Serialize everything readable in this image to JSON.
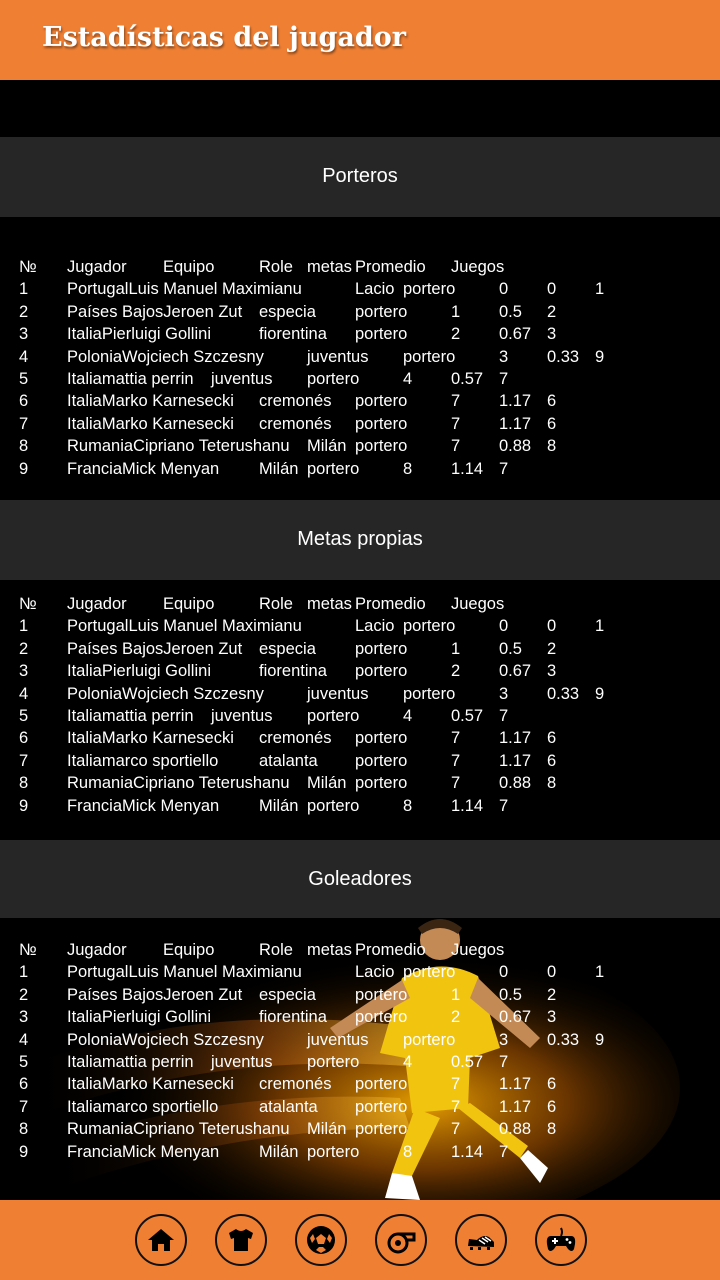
{
  "header": {
    "title": "Estadísticas del jugador"
  },
  "columns": [
    "№",
    "Jugador",
    "Equipo",
    "Role",
    "metas",
    "Promedio",
    "Juegos"
  ],
  "rows": [
    [
      "1",
      "PortugalLuis Manuel Maximianu",
      "Lacio",
      "portero",
      "0",
      "0",
      "1"
    ],
    [
      "2",
      "Países BajosJeroen Zut",
      "especia",
      "portero",
      "1",
      "0.5",
      "2"
    ],
    [
      "3",
      "ItaliaPierluigi Gollini",
      "fiorentina",
      "portero",
      "2",
      "0.67",
      "3"
    ],
    [
      "4",
      "PoloniaWojciech Szczesny",
      "juventus",
      "portero",
      "3",
      "0.33",
      "9"
    ],
    [
      "5",
      "Italiamattia perrin",
      "juventus",
      "portero",
      "4",
      "0.57",
      "7"
    ],
    [
      "6",
      "ItaliaMarko Karnesecki",
      "cremonés",
      "portero",
      "7",
      "1.17",
      "6"
    ],
    [
      "7",
      "ItaliaMarko Karnesecki",
      "cremonés",
      "portero",
      "7",
      "1.17",
      "6"
    ],
    [
      "8",
      "RumaniaCipriano Teterushanu",
      "Milán",
      "portero",
      "7",
      "0.88",
      "8"
    ],
    [
      "9",
      "FranciaMick Menyan",
      "Milán",
      "portero",
      "8",
      "1.14",
      "7"
    ]
  ],
  "sections": [
    {
      "title": "Porteros",
      "row7_player": "ItaliaMarko Karnesecki",
      "row7_team": "cremonés"
    },
    {
      "title": "Metas propias",
      "row7_player": "Italiamarco sportiello",
      "row7_team": "atalanta"
    },
    {
      "title": "Goleadores",
      "row7_player": "Italiamarco sportiello",
      "row7_team": "atalanta"
    }
  ],
  "footer": {
    "icons": [
      "home-icon",
      "jersey-icon",
      "soccer-ball-icon",
      "whistle-icon",
      "football-boot-icon",
      "gamepad-icon"
    ]
  },
  "colors": {
    "accent": "#ee7f33",
    "band": "#262626",
    "background": "#000000"
  }
}
